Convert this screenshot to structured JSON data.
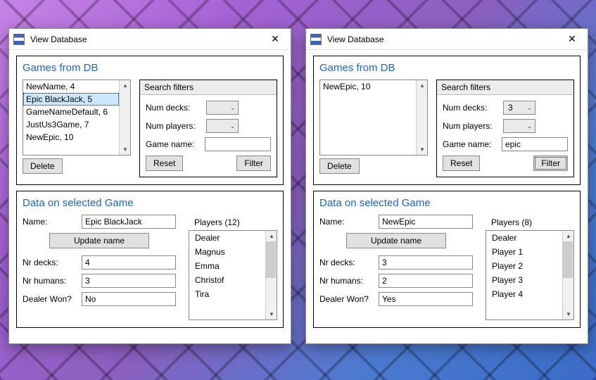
{
  "windows": [
    {
      "title": "View Database",
      "games_heading": "Games from DB",
      "games": [
        "NewName, 4",
        "Epic BlackJack, 5",
        "GameNameDefault, 6",
        "JustUs3Game, 7",
        "NewEpic, 10"
      ],
      "selected_game_index": 1,
      "delete_label": "Delete",
      "filters": {
        "heading": "Search filters",
        "num_decks_label": "Num decks:",
        "num_decks_value": "",
        "num_players_label": "Num players:",
        "num_players_value": "",
        "game_name_label": "Game name:",
        "game_name_value": "",
        "reset_label": "Reset",
        "filter_label": "Filter",
        "filter_focused": false
      },
      "data_heading": "Data on selected Game",
      "name_label": "Name:",
      "name_value": "Epic BlackJack",
      "update_name_label": "Update name",
      "nr_decks_label": "Nr decks:",
      "nr_decks_value": "4",
      "nr_humans_label": "Nr humans:",
      "nr_humans_value": "3",
      "dealer_won_label": "Dealer Won?",
      "dealer_won_value": "No",
      "players_heading": "Players (12)",
      "players": [
        "Dealer",
        "Magnus",
        "Emma",
        "Christof",
        "Tira"
      ]
    },
    {
      "title": "View Database",
      "games_heading": "Games from DB",
      "games": [
        "NewEpic, 10"
      ],
      "selected_game_index": -1,
      "delete_label": "Delete",
      "filters": {
        "heading": "Search filters",
        "num_decks_label": "Num decks:",
        "num_decks_value": "3",
        "num_players_label": "Num players:",
        "num_players_value": "",
        "game_name_label": "Game name:",
        "game_name_value": "epic",
        "reset_label": "Reset",
        "filter_label": "Filter",
        "filter_focused": true
      },
      "data_heading": "Data on selected Game",
      "name_label": "Name:",
      "name_value": "NewEpic",
      "update_name_label": "Update name",
      "nr_decks_label": "Nr decks:",
      "nr_decks_value": "3",
      "nr_humans_label": "Nr humans:",
      "nr_humans_value": "2",
      "dealer_won_label": "Dealer Won?",
      "dealer_won_value": "Yes",
      "players_heading": "Players (8)",
      "players": [
        "Dealer",
        "Player 1",
        "Player 2",
        "Player 3",
        "Player 4"
      ]
    }
  ]
}
